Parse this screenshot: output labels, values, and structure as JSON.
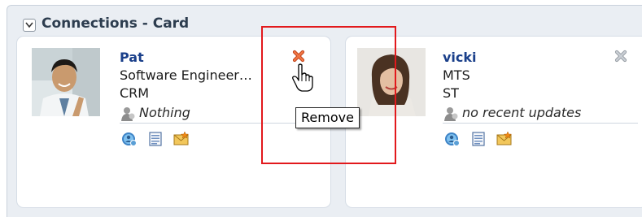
{
  "panel": {
    "title": "Connections - Card"
  },
  "cards": [
    {
      "name": "Pat",
      "title": "Software Engineer…",
      "dept": "CRM",
      "status": "Nothing",
      "actions": [
        "connection-icon",
        "profile-list-icon",
        "email-icon"
      ]
    },
    {
      "name": "vicki",
      "title": "MTS",
      "dept": "ST",
      "status": "no recent updates",
      "actions": [
        "connection-icon",
        "profile-list-icon",
        "email-icon"
      ]
    }
  ],
  "tooltip": {
    "text": "Remove"
  },
  "colors": {
    "highlight": "#e2191c",
    "name": "#1a3f8a",
    "remove_active": "#e05a30",
    "remove_inactive": "#a9b0b8"
  }
}
